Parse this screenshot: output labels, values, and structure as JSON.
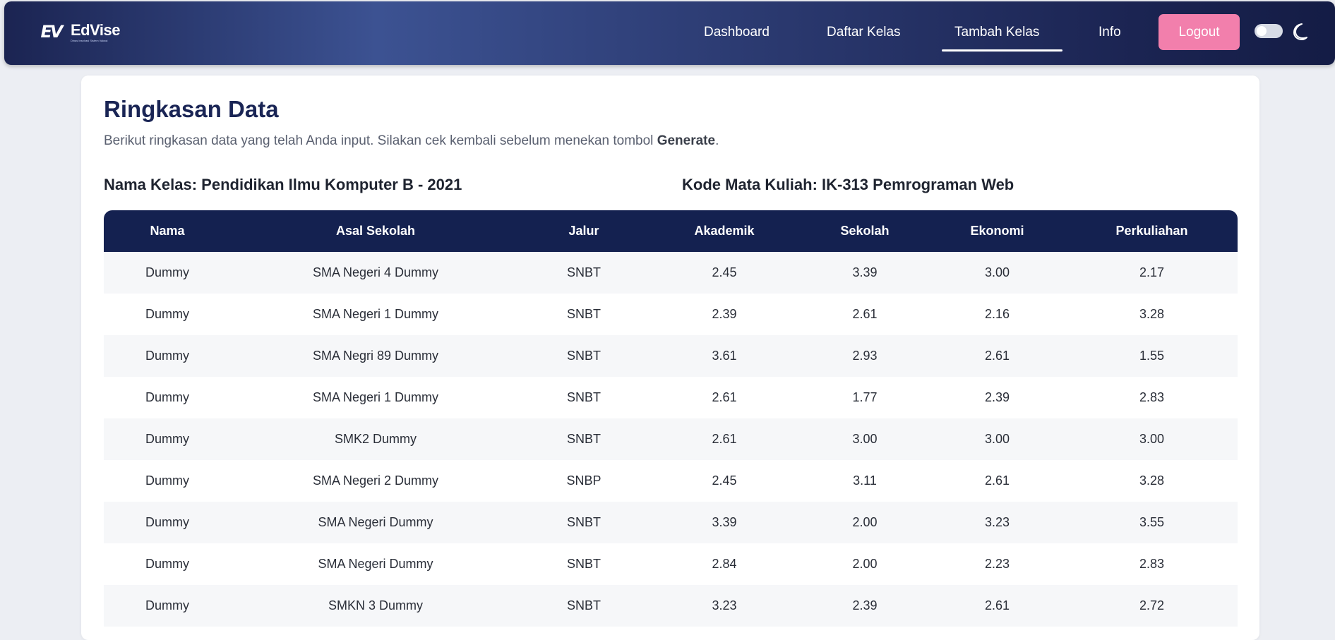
{
  "brand": {
    "logo_mark": "EV",
    "name": "EdVise",
    "tagline": "Dinas Inspirasi Sistem Vakasi"
  },
  "nav": {
    "items": [
      "Dashboard",
      "Daftar Kelas",
      "Tambah Kelas",
      "Info"
    ],
    "active": "Tambah Kelas",
    "logout_label": "Logout",
    "theme_toggle_icon": "moon-icon"
  },
  "summary": {
    "title": "Ringkasan Data",
    "description": "Berikut ringkasan data yang telah Anda input. Silakan cek kembali sebelum menekan tombol ",
    "description_bold": "Generate",
    "description_end": ".",
    "class_name": "Nama Kelas: Pendidikan Ilmu Komputer B - 2021",
    "course_code": "Kode Mata Kuliah: IK-313 Pemrograman Web"
  },
  "table": {
    "headers": [
      "Nama",
      "Asal Sekolah",
      "Jalur",
      "Akademik",
      "Sekolah",
      "Ekonomi",
      "Perkuliahan"
    ],
    "rows": [
      [
        "Dummy",
        "SMA Negeri 4 Dummy",
        "SNBT",
        "2.45",
        "3.39",
        "3.00",
        "2.17"
      ],
      [
        "Dummy",
        "SMA Negeri 1 Dummy",
        "SNBT",
        "2.39",
        "2.61",
        "2.16",
        "3.28"
      ],
      [
        "Dummy",
        "SMA Negri 89 Dummy",
        "SNBT",
        "3.61",
        "2.93",
        "2.61",
        "1.55"
      ],
      [
        "Dummy",
        "SMA Negeri 1 Dummy",
        "SNBT",
        "2.61",
        "1.77",
        "2.39",
        "2.83"
      ],
      [
        "Dummy",
        "SMK2 Dummy",
        "SNBT",
        "2.61",
        "3.00",
        "3.00",
        "3.00"
      ],
      [
        "Dummy",
        "SMA Negeri 2 Dummy",
        "SNBP",
        "2.45",
        "3.11",
        "2.61",
        "3.28"
      ],
      [
        "Dummy",
        "SMA Negeri Dummy",
        "SNBT",
        "3.39",
        "2.00",
        "3.23",
        "3.55"
      ],
      [
        "Dummy",
        "SMA Negeri Dummy",
        "SNBT",
        "2.84",
        "2.00",
        "2.23",
        "2.83"
      ],
      [
        "Dummy",
        "SMKN 3 Dummy",
        "SNBT",
        "3.23",
        "2.39",
        "2.61",
        "2.72"
      ]
    ]
  },
  "colors": {
    "navbar_start": "#1b2452",
    "navbar_mid": "#3c5292",
    "logout_bg": "#f27fac",
    "table_header_bg": "#142150",
    "title_color": "#1a2555",
    "page_bg": "#eceef3"
  }
}
